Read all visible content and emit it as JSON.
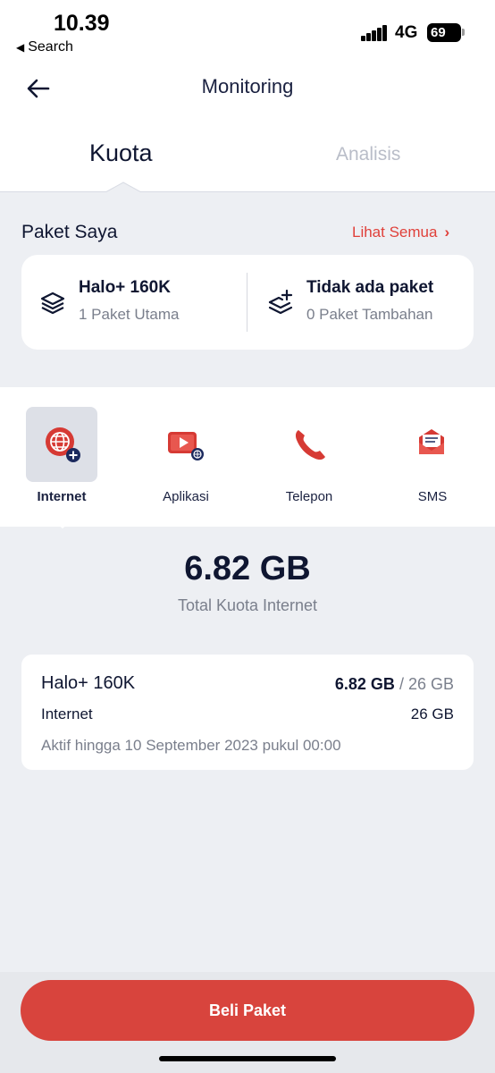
{
  "status": {
    "time": "10.39",
    "back_label": "Search",
    "network": "4G",
    "battery": "69"
  },
  "header": {
    "title": "Monitoring",
    "tabs": [
      {
        "label": "Kuota",
        "active": true
      },
      {
        "label": "Analisis",
        "active": false
      }
    ]
  },
  "my_packages": {
    "title": "Paket Saya",
    "see_all": "Lihat Semua",
    "main": {
      "name": "Halo+ 160K",
      "sub": "1 Paket Utama",
      "icon": "layers-icon"
    },
    "addon": {
      "name": "Tidak ada paket",
      "sub": "0 Paket Tambahan",
      "icon": "add-layer-icon"
    }
  },
  "categories": [
    {
      "label": "Internet",
      "icon": "internet-globe-icon",
      "active": true
    },
    {
      "label": "Aplikasi",
      "icon": "app-video-icon",
      "active": false
    },
    {
      "label": "Telepon",
      "icon": "phone-icon",
      "active": false
    },
    {
      "label": "SMS",
      "icon": "sms-envelope-icon",
      "active": false
    }
  ],
  "total": {
    "value": "6.82 GB",
    "label": "Total Kuota Internet"
  },
  "detail": {
    "name": "Halo+ 160K",
    "remaining": "6.82 GB",
    "separator": "/",
    "total": "26 GB",
    "type": "Internet",
    "type_value": "26 GB",
    "active_until": "Aktif hingga 10 September 2023 pukul 00:00"
  },
  "buy_button": "Beli Paket",
  "colors": {
    "accent": "#d8443d",
    "link": "#e0403a",
    "text": "#0f1631",
    "muted": "#7a7f8c"
  }
}
